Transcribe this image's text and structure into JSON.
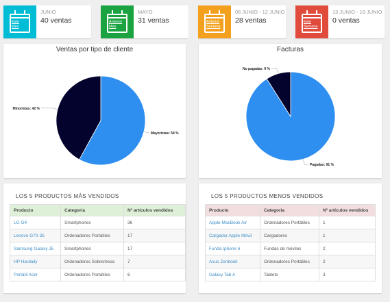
{
  "stats": [
    {
      "color": "#00bcd4",
      "icon_label": "Este\nMes",
      "period": "JUNIO",
      "count": "40 ventas"
    },
    {
      "color": "#1aa340",
      "icon_label": "Anterior\nMes",
      "period": "MAYO",
      "count": "31 ventas"
    },
    {
      "color": "#f2a01d",
      "icon_label": "Anterior\nSemana",
      "period": "06 JUNIO - 12 JUNIO",
      "count": "28 ventas"
    },
    {
      "color": "#e04b3c",
      "icon_label": "Este\nSemana",
      "period": "13 JUNIO - 19 JUNIO",
      "count": "0 ventas"
    }
  ],
  "chart_data": [
    {
      "type": "pie",
      "title": "Ventas por tipo de cliente",
      "slices": [
        {
          "label": "Mayoristas",
          "value": 58,
          "display": "Mayoristas: 58 %",
          "color": "#2f8ff0"
        },
        {
          "label": "Minoristas",
          "value": 42,
          "display": "Minoristas: 42 %",
          "color": "#03032e"
        }
      ]
    },
    {
      "type": "pie",
      "title": "Facturas",
      "slices": [
        {
          "label": "Pagadas",
          "value": 91,
          "display": "Pagadas: 91 %",
          "color": "#2f8ff0"
        },
        {
          "label": "No pagadas",
          "value": 9,
          "display": "No pagadas: 9 %",
          "color": "#03032e"
        }
      ]
    }
  ],
  "top_table": {
    "title": "LOS 5 PRODUCTOS MÁS VENDIDOS",
    "header_color": "#dff0d8",
    "columns": [
      "Producto",
      "Categoria",
      "Nº artículos vendidos"
    ],
    "rows": [
      [
        "LG G4",
        "Smartphones",
        "36"
      ],
      [
        "Lenovo G70-35",
        "Ordenadores Portátiles",
        "17"
      ],
      [
        "Samsung Galaxy J5",
        "Smartphones",
        "17"
      ],
      [
        "HP Hardaily",
        "Ordenadores Sobremesa",
        "7"
      ],
      [
        "Portátil Acer",
        "Ordenadores Portátiles",
        "6"
      ]
    ]
  },
  "bottom_table": {
    "title": "LOS 5 PRODUCTOS MENOS VENDIDOS",
    "header_color": "#f2dede",
    "columns": [
      "Producto",
      "Categoria",
      "Nº artículos vendidos"
    ],
    "rows": [
      [
        "Apple MacBook Air",
        "Ordenadores Portátiles",
        "1"
      ],
      [
        "Cargador Apple Móvil",
        "Cargadores",
        "1"
      ],
      [
        "Funda Iphone 6",
        "Fundas de móviles",
        "2"
      ],
      [
        "Asus Zenbook",
        "Ordenadores Portátiles",
        "2"
      ],
      [
        "Galaxy Tab A",
        "Tablets",
        "3"
      ]
    ]
  }
}
